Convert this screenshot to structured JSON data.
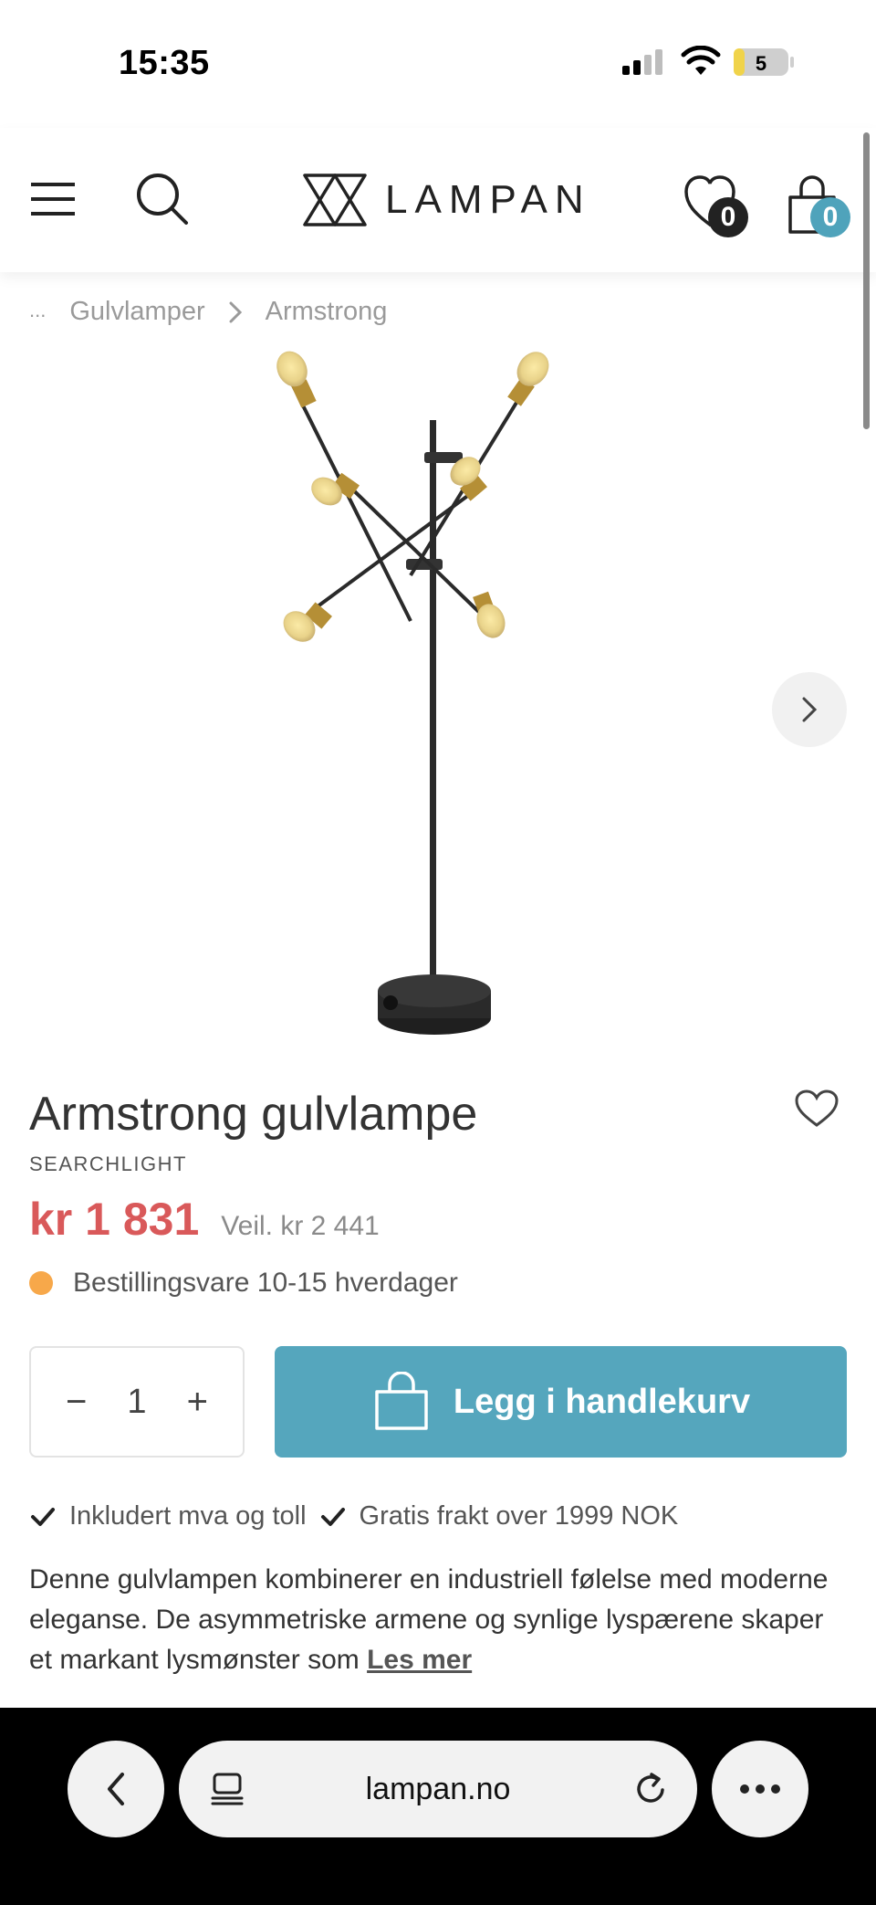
{
  "status_bar": {
    "time": "15:35",
    "battery": "5"
  },
  "header": {
    "logo_text": "LAMPAN",
    "wishlist_count": "0",
    "cart_count": "0"
  },
  "breadcrumb": {
    "ellipsis": "...",
    "items": [
      "Gulvlamper",
      "Armstrong"
    ]
  },
  "product": {
    "title": "Armstrong gulvlampe",
    "brand": "SEARCHLIGHT",
    "price": "kr 1 831",
    "rrp": "Veil. kr 2 441",
    "stock": "Bestillingsvare 10-15 hverdager",
    "quantity": "1",
    "add_to_cart": "Legg i handlekurv",
    "usps": [
      "Inkludert mva og toll",
      "Gratis frakt over 1999 NOK"
    ],
    "description": "Denne gulvlampen kombinerer en industriell følelse med moderne eleganse. De asymmetriske armene og synlige lyspærene skaper et markant lysmønster som",
    "read_more": "Les mer"
  },
  "browser": {
    "url": "lampan.no"
  },
  "colors": {
    "price": "#d9595a",
    "accent": "#55a6bd",
    "stock_dot": "#f7a84a"
  }
}
